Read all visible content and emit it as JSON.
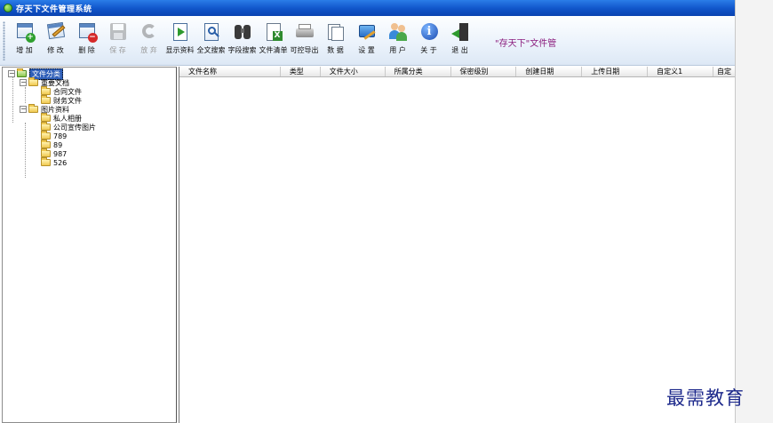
{
  "window": {
    "title": "存天下文件管理系统"
  },
  "toolbar": {
    "buttons": [
      {
        "label": "增 加",
        "icon": "add-icon",
        "enabled": true
      },
      {
        "label": "修 改",
        "icon": "edit-icon",
        "enabled": true
      },
      {
        "label": "删 除",
        "icon": "delete-icon",
        "enabled": true
      },
      {
        "label": "保 存",
        "icon": "save-icon",
        "enabled": false
      },
      {
        "label": "放 弃",
        "icon": "undo-icon",
        "enabled": false
      },
      {
        "label": "显示资料",
        "icon": "show-data-icon",
        "enabled": true
      },
      {
        "label": "全文搜索",
        "icon": "fulltext-search-icon",
        "enabled": true
      },
      {
        "label": "字段搜索",
        "icon": "binoculars-icon",
        "enabled": true
      },
      {
        "label": "文件清单",
        "icon": "file-list-icon",
        "enabled": true
      },
      {
        "label": "可控导出",
        "icon": "export-icon",
        "enabled": true
      },
      {
        "label": "数 据",
        "icon": "data-icon",
        "enabled": true
      },
      {
        "label": "设 置",
        "icon": "settings-icon",
        "enabled": true
      },
      {
        "label": "用 户",
        "icon": "users-icon",
        "enabled": true
      },
      {
        "label": "关 于",
        "icon": "info-icon",
        "enabled": true
      },
      {
        "label": "退 出",
        "icon": "exit-icon",
        "enabled": true
      }
    ],
    "slogan": "\"存天下\"文件管"
  },
  "tree": {
    "root": "文件分类",
    "groups": [
      {
        "label": "重要文档",
        "children": [
          "合同文件",
          "财务文件"
        ]
      },
      {
        "label": "图片资料",
        "children": [
          "私人相册",
          "公司宣传图片",
          "789",
          "89",
          "987",
          "526"
        ]
      }
    ]
  },
  "list": {
    "columns": [
      "文件名称",
      "类型",
      "文件大小",
      "所属分类",
      "保密级别",
      "创建日期",
      "上传日期",
      "自定义1",
      "自定"
    ]
  },
  "watermark": "最需教育"
}
